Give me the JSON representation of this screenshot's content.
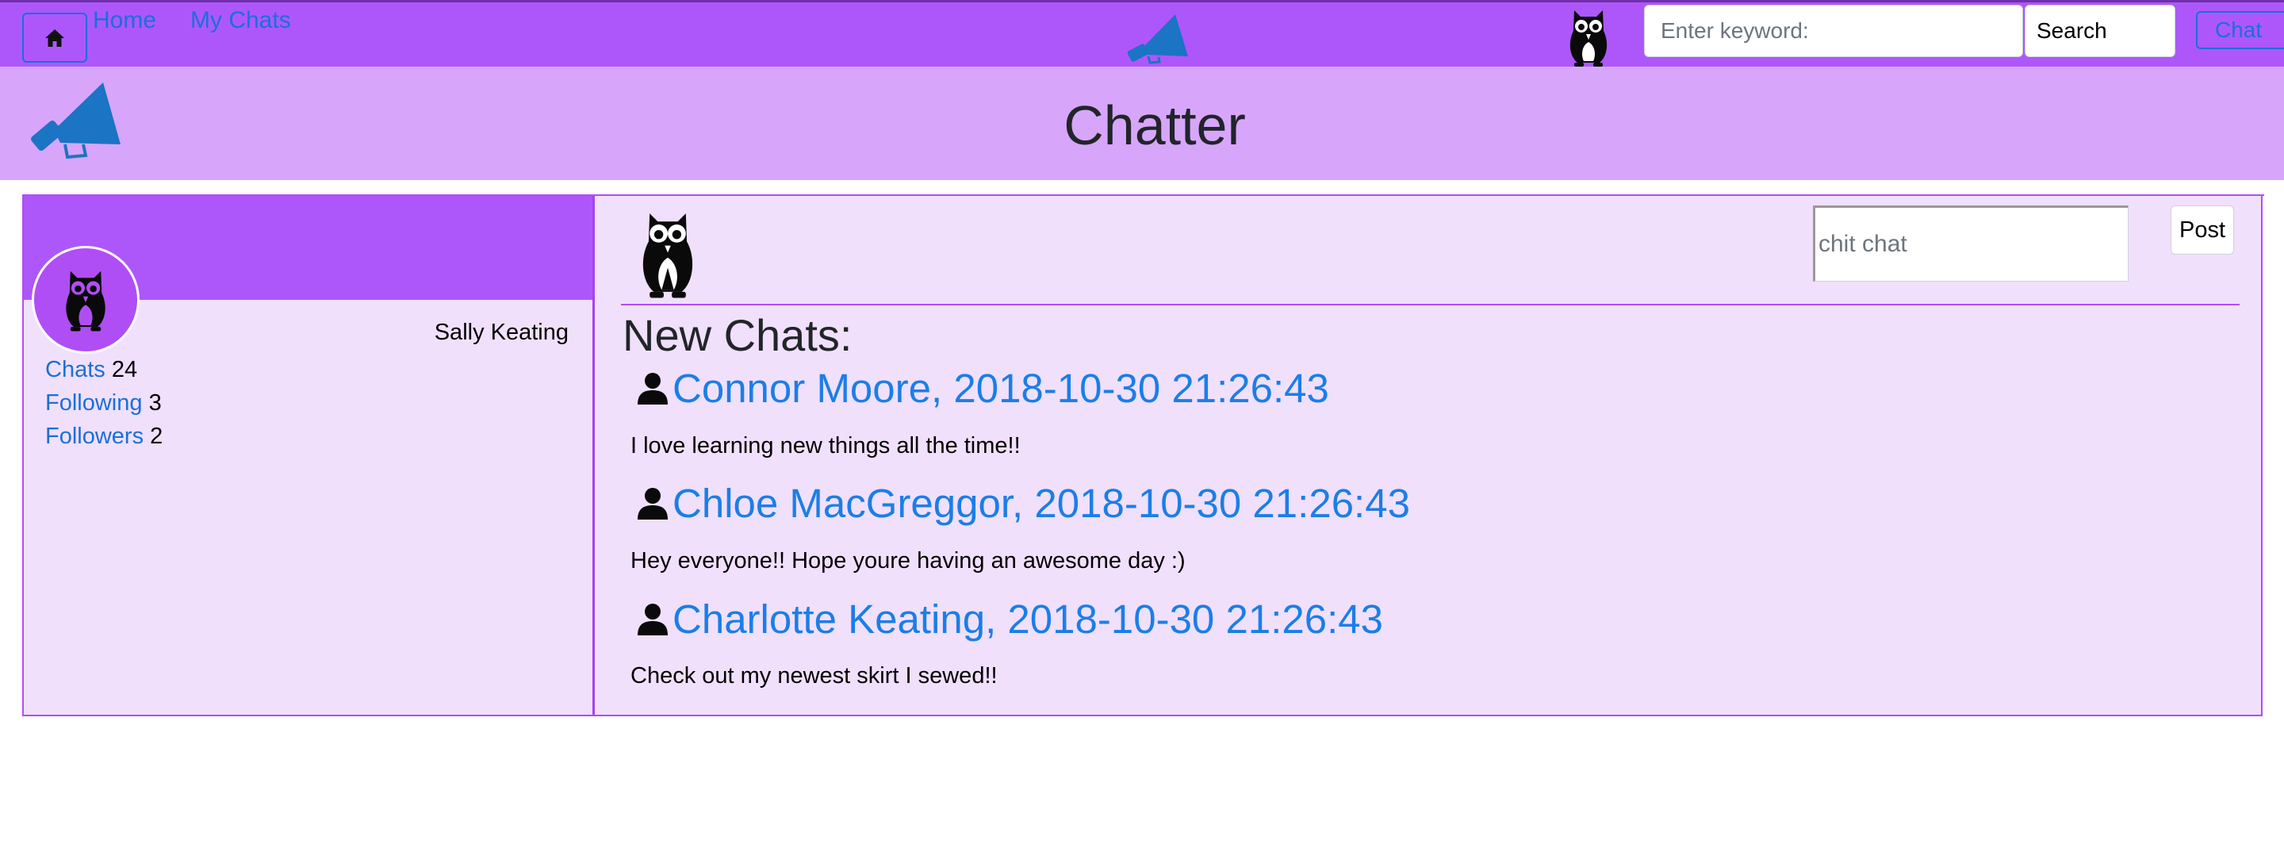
{
  "navbar": {
    "links": [
      "Home",
      "My Chats"
    ],
    "search_placeholder": "Enter keyword:",
    "search_button": "Search",
    "chat_button": "Chat"
  },
  "banner": {
    "title": "Chatter"
  },
  "profile": {
    "name": "Sally Keating",
    "stats": [
      {
        "label": "Chats",
        "count": "24"
      },
      {
        "label": "Following",
        "count": "3"
      },
      {
        "label": "Followers",
        "count": "2"
      }
    ]
  },
  "feed": {
    "post_placeholder": "chit chat",
    "post_button": "Post",
    "heading": "New Chats:",
    "chats": [
      {
        "author": "Connor Moore, 2018-10-30 21:26:43",
        "text": "I love learning new things all the time!!"
      },
      {
        "author": "Chloe MacGreggor, 2018-10-30 21:26:43",
        "text": "Hey everyone!! Hope youre having an awesome day :)"
      },
      {
        "author": "Charlotte Keating, 2018-10-30 21:26:43",
        "text": "Check out my newest skirt I sewed!!"
      }
    ]
  },
  "icons": {
    "home": "home-icon",
    "megaphone": "megaphone-icon",
    "owl": "owl-icon",
    "person": "person-icon"
  },
  "colors": {
    "navbar": "#ad57fa",
    "banner": "#d7a6fb",
    "panel": "#f0e0fc",
    "border": "#b04ef5",
    "link": "#1b6fd8",
    "megaphone": "#1b74c4"
  }
}
